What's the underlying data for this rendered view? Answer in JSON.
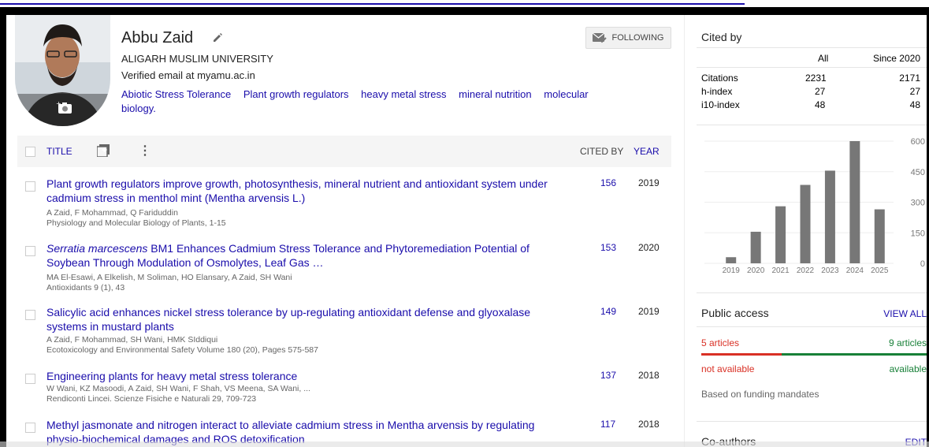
{
  "profile": {
    "name": "Abbu Zaid",
    "affiliation": "ALIGARH MUSLIM UNIVERSITY",
    "email": "Verified email at myamu.ac.in",
    "interests": [
      "Abiotic Stress Tolerance",
      "Plant growth regulators",
      "heavy metal stress",
      "mineral nutrition",
      "molecular biology."
    ],
    "follow_label": "FOLLOWING"
  },
  "table": {
    "title_header": "TITLE",
    "cited_by_header": "CITED BY",
    "year_header": "YEAR"
  },
  "publications": [
    {
      "title": "Plant growth regulators improve growth, photosynthesis, mineral nutrient and antioxidant system under cadmium stress in menthol mint (Mentha arvensis L.)",
      "authors": "A Zaid, F Mohammad, Q Fariduddin",
      "venue": "Physiology and Molecular Biology of Plants, 1-15",
      "cited": "156",
      "year": "2019"
    },
    {
      "title_italic": "Serratia marcescens",
      "title": " BM1 Enhances Cadmium Stress Tolerance and Phytoremediation Potential of Soybean Through Modulation of Osmolytes, Leaf Gas …",
      "authors": "MA El-Esawi, A Elkelish, M Soliman, HO Elansary, A Zaid, SH Wani",
      "venue": "Antioxidants 9 (1), 43",
      "cited": "153",
      "year": "2020"
    },
    {
      "title": "Salicylic acid enhances nickel stress tolerance by up-regulating antioxidant defense and glyoxalase systems in mustard plants",
      "authors": "A Zaid, F Mohammad, SH Wani, HMK SIddiqui",
      "venue": "Ecotoxicology and Environmental Safety Volume 180 (20), Pages 575-587",
      "cited": "149",
      "year": "2019"
    },
    {
      "title": "Engineering plants for heavy metal stress tolerance",
      "authors": "W Wani, KZ Masoodi, A Zaid, SH Wani, F Shah, VS Meena, SA Wani, ...",
      "venue": "Rendiconti Lincei. Scienze Fisiche e Naturali 29, 709-723",
      "cited": "137",
      "year": "2018"
    },
    {
      "title": "Methyl jasmonate and nitrogen interact to alleviate cadmium stress in Mentha arvensis by regulating physio-biochemical damages and ROS detoxification",
      "authors": "",
      "venue": "",
      "cited": "117",
      "year": "2018"
    }
  ],
  "cited_by": {
    "heading": "Cited by",
    "col_all": "All",
    "col_since": "Since 2020",
    "rows": [
      {
        "label": "Citations",
        "all": "2231",
        "since": "2171"
      },
      {
        "label": "h-index",
        "all": "27",
        "since": "27"
      },
      {
        "label": "i10-index",
        "all": "48",
        "since": "48"
      }
    ]
  },
  "chart_data": {
    "type": "bar",
    "categories": [
      "2019",
      "2020",
      "2021",
      "2022",
      "2023",
      "2024",
      "2025"
    ],
    "values": [
      30,
      155,
      280,
      385,
      455,
      600,
      265
    ],
    "ylim": [
      0,
      600
    ],
    "yticks": [
      "0",
      "150",
      "300",
      "450",
      "600"
    ],
    "bar_color": "#777777"
  },
  "public_access": {
    "heading": "Public access",
    "view_all": "VIEW ALL",
    "not_available_count": "5 articles",
    "available_count": "9 articles",
    "not_available_label": "not available",
    "available_label": "available",
    "note": "Based on funding mandates",
    "not_available_fraction": 0.357,
    "colors": {
      "not_available": "#d93025",
      "available": "#188038"
    }
  },
  "coauthors": {
    "heading": "Co-authors",
    "edit": "EDIT"
  }
}
